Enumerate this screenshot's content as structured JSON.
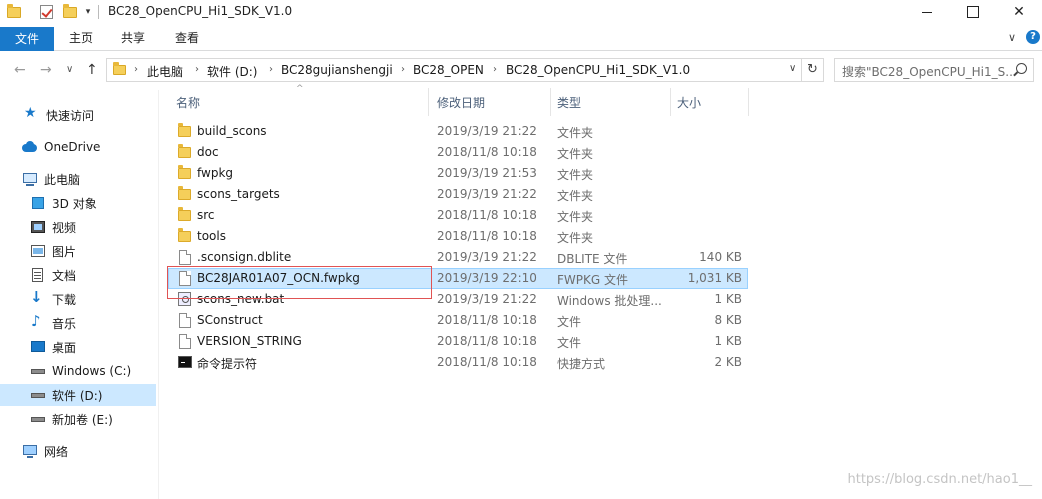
{
  "window": {
    "title": "BC28_OpenCPU_Hi1_SDK_V1.0",
    "minimize_glyph": "",
    "maximize_glyph": "",
    "close_glyph": "✕"
  },
  "ribbon": {
    "tabs": [
      "文件",
      "主页",
      "共享",
      "查看"
    ],
    "expand_glyph": "∨",
    "help_glyph": "?"
  },
  "nav": {
    "back_glyph": "←",
    "forward_glyph": "→",
    "recent_glyph": "∨",
    "up_glyph": "↑",
    "breadcrumbs": [
      "此电脑",
      "软件 (D:)",
      "BC28gujianshengji",
      "BC28_OPEN",
      "BC28_OpenCPU_Hi1_SDK_V1.0"
    ],
    "crumb_sep": "›",
    "dropdown_glyph": "∨",
    "refresh_glyph": "↻",
    "search_placeholder": "搜索\"BC28_OpenCPU_Hi1_S..."
  },
  "sidebar": {
    "items": [
      {
        "label": "快速访问",
        "icon": "star-icon"
      },
      {
        "label": "OneDrive",
        "icon": "cloud-icon"
      },
      {
        "label": "此电脑",
        "icon": "computer-icon"
      },
      {
        "label": "3D 对象",
        "icon": "cube-icon"
      },
      {
        "label": "视频",
        "icon": "video-icon"
      },
      {
        "label": "图片",
        "icon": "picture-icon"
      },
      {
        "label": "文档",
        "icon": "document-icon"
      },
      {
        "label": "下载",
        "icon": "download-icon"
      },
      {
        "label": "音乐",
        "icon": "music-icon"
      },
      {
        "label": "桌面",
        "icon": "desktop-icon"
      },
      {
        "label": "Windows (C:)",
        "icon": "drive-icon"
      },
      {
        "label": "软件 (D:)",
        "icon": "drive-icon"
      },
      {
        "label": "新加卷 (E:)",
        "icon": "drive-icon"
      },
      {
        "label": "网络",
        "icon": "network-icon"
      }
    ]
  },
  "list": {
    "columns": {
      "name": "名称",
      "date": "修改日期",
      "type": "类型",
      "size": "大小"
    },
    "sort_glyph": "^",
    "rows": [
      {
        "name": "build_scons",
        "date": "2019/3/19 21:22",
        "type": "文件夹",
        "size": "",
        "kind": "folder"
      },
      {
        "name": "doc",
        "date": "2018/11/8 10:18",
        "type": "文件夹",
        "size": "",
        "kind": "folder"
      },
      {
        "name": "fwpkg",
        "date": "2019/3/19 21:53",
        "type": "文件夹",
        "size": "",
        "kind": "folder"
      },
      {
        "name": "scons_targets",
        "date": "2019/3/19 21:22",
        "type": "文件夹",
        "size": "",
        "kind": "folder"
      },
      {
        "name": "src",
        "date": "2018/11/8 10:18",
        "type": "文件夹",
        "size": "",
        "kind": "folder"
      },
      {
        "name": "tools",
        "date": "2018/11/8 10:18",
        "type": "文件夹",
        "size": "",
        "kind": "folder"
      },
      {
        "name": ".sconsign.dblite",
        "date": "2019/3/19 21:22",
        "type": "DBLITE 文件",
        "size": "140 KB",
        "kind": "file"
      },
      {
        "name": "BC28JAR01A07_OCN.fwpkg",
        "date": "2019/3/19 22:10",
        "type": "FWPKG 文件",
        "size": "1,031 KB",
        "kind": "file"
      },
      {
        "name": "scons_new.bat",
        "date": "2019/3/19 21:22",
        "type": "Windows 批处理...",
        "size": "1 KB",
        "kind": "bat"
      },
      {
        "name": "SConstruct",
        "date": "2018/11/8 10:18",
        "type": "文件",
        "size": "8 KB",
        "kind": "file"
      },
      {
        "name": "VERSION_STRING",
        "date": "2018/11/8 10:18",
        "type": "文件",
        "size": "1 KB",
        "kind": "file"
      },
      {
        "name": "命令提示符",
        "date": "2018/11/8 10:18",
        "type": "快捷方式",
        "size": "2 KB",
        "kind": "shortcut"
      }
    ]
  },
  "watermark": "https://blog.csdn.net/hao1__",
  "colors": {
    "accent": "#1979ca",
    "selection": "#cce8ff",
    "annotation": "#e05353"
  }
}
